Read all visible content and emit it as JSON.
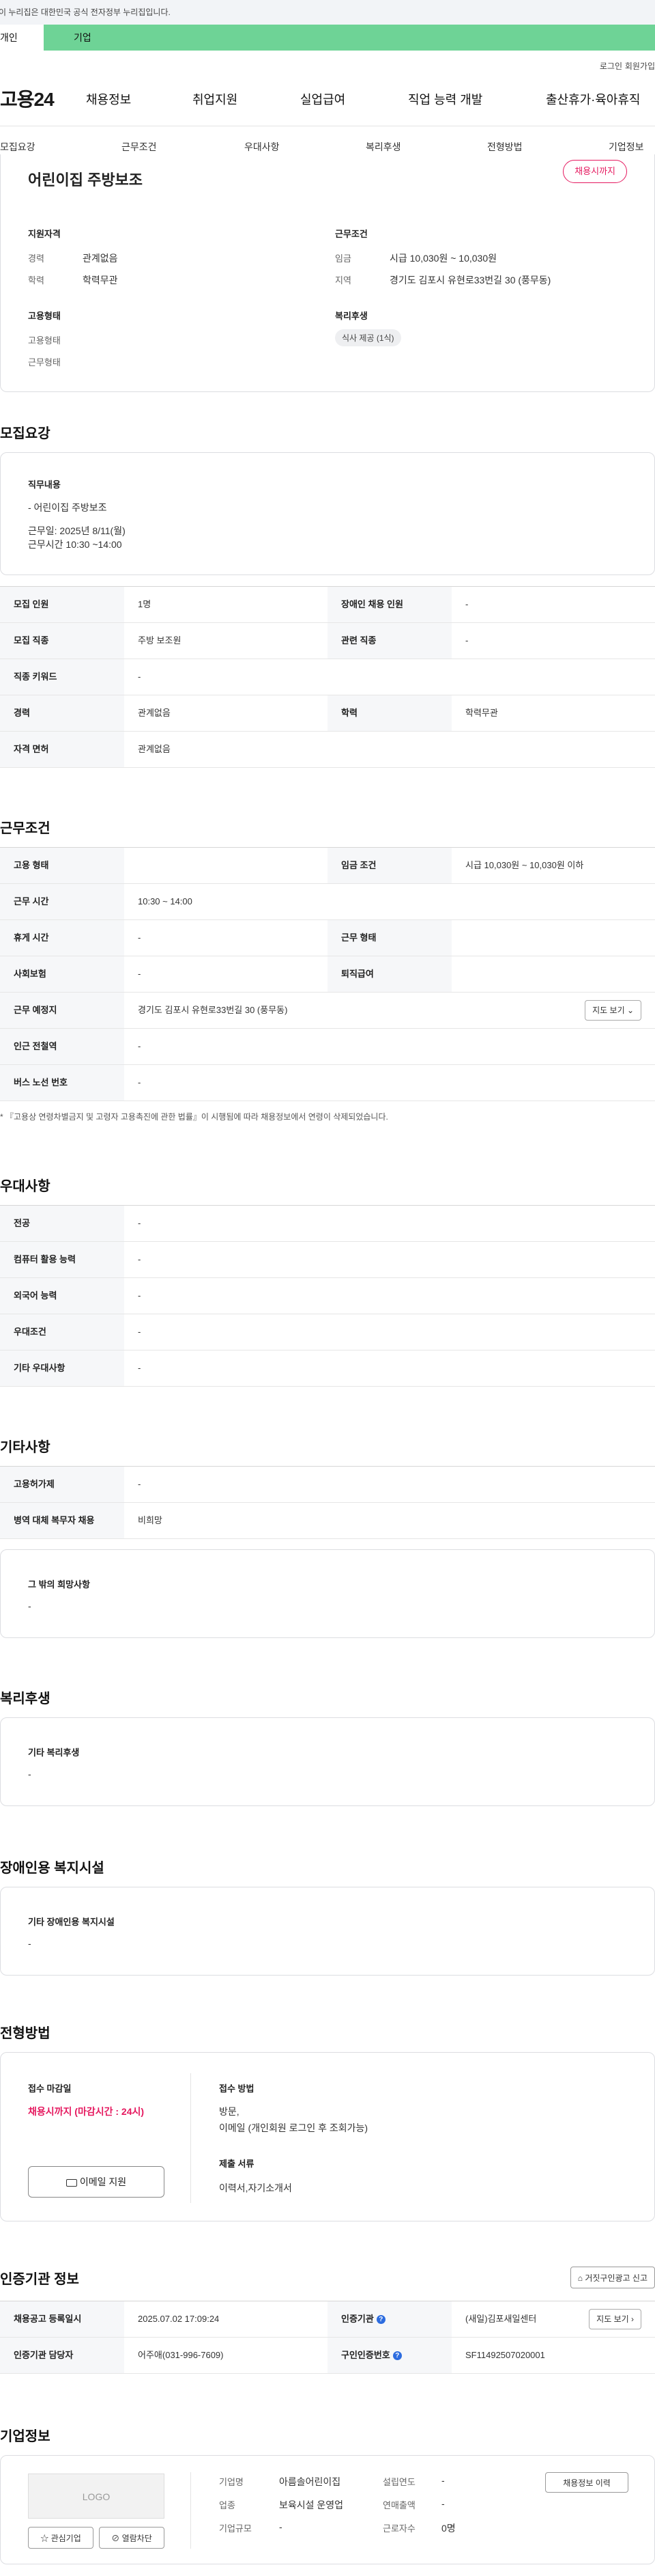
{
  "banner": {
    "text": "이 누리집은 대한민국 공식 전자정부 누리집입니다."
  },
  "user_tabs": {
    "personal": "개인",
    "corp": "기업"
  },
  "util": {
    "login": "로그인",
    "join": "회원가입"
  },
  "gnb": {
    "logo": "고용24",
    "menu": [
      "채용정보",
      "취업지원",
      "실업급여",
      "직업 능력 개발",
      "출산휴가·육아휴직"
    ]
  },
  "subnav": [
    "모집요강",
    "근무조건",
    "우대사항",
    "복리후생",
    "전형방법",
    "기업정보"
  ],
  "job": {
    "title": "어린이집 주방보조",
    "status_badge": "채용시까지",
    "qual_title": "지원자격",
    "qual": [
      {
        "k": "경력",
        "v": "관계없음"
      },
      {
        "k": "학력",
        "v": "학력무관"
      }
    ],
    "cond_title": "근무조건",
    "cond": [
      {
        "k": "임금",
        "v": "시급 10,030원 ~ 10,030원"
      },
      {
        "k": "지역",
        "v": "경기도 김포시 유현로33번길 30 (풍무동)"
      }
    ],
    "emp_title": "고용형태",
    "emp": [
      "고용형태",
      "근무형태"
    ],
    "welfare_title": "복리후생",
    "welfare_pill": "식사 제공 (1식)"
  },
  "recruit": {
    "section": "모집요강",
    "duty_title": "직무내용",
    "duty_lines": [
      "- 어린이집 주방보조",
      "근무일: 2025년 8/11(월)",
      "근무시간 10:30 ~14:00"
    ],
    "rows": [
      {
        "th1": "모집 인원",
        "td1": "1명",
        "th2": "장애인 채용 인원",
        "td2": "-"
      },
      {
        "th1": "모집 직종",
        "td1": "주방 보조원",
        "th2": "관련 직종",
        "td2": "-"
      },
      {
        "th1": "직종 키워드",
        "td1": "-"
      },
      {
        "th1": "경력",
        "td1": "관계없음",
        "th2": "학력",
        "td2": "학력무관"
      },
      {
        "th1": "자격 면허",
        "td1": "관계없음"
      }
    ]
  },
  "workcond": {
    "section": "근무조건",
    "rows": [
      {
        "th1": "고용 형태",
        "td1": "",
        "th2": "임금 조건",
        "td2": "시급 10,030원 ~ 10,030원 이하"
      },
      {
        "th1": "근무 시간",
        "td1": "10:30 ~ 14:00"
      },
      {
        "th1": "휴게 시간",
        "td1": "-",
        "th2": "근무 형태",
        "td2": ""
      },
      {
        "th1": "사회보험",
        "td1": "-",
        "th2": "퇴직급여",
        "td2": ""
      },
      {
        "th1": "근무 예정지",
        "td1": "경기도 김포시 유현로33번길 30 (풍무동)",
        "btn": "지도 보기 ⌄"
      },
      {
        "th1": "인근 전철역",
        "td1": "-"
      },
      {
        "th1": "버스 노선 번호",
        "td1": "-"
      }
    ],
    "note": "* 『고용상 연령차별금지 및 고령자 고용촉진에 관한 법률』이 시행됨에 따라 채용정보에서 연령이 삭제되었습니다."
  },
  "pref": {
    "section": "우대사항",
    "rows": [
      {
        "th1": "전공",
        "td1": "-"
      },
      {
        "th1": "컴퓨터 활용 능력",
        "td1": "-"
      },
      {
        "th1": "외국어 능력",
        "td1": "-"
      },
      {
        "th1": "우대조건",
        "td1": "-"
      },
      {
        "th1": "기타 우대사항",
        "td1": "-"
      }
    ]
  },
  "etc": {
    "section": "기타사항",
    "rows": [
      {
        "th1": "고용허가제",
        "td1": "-"
      },
      {
        "th1": "병역 대체 복무자 채용",
        "td1": "비희망"
      }
    ],
    "box_title": "그 밖의 희망사항",
    "box_val": "-"
  },
  "welfare": {
    "section": "복리후생",
    "box_title": "기타 복리후생",
    "box_val": "-"
  },
  "disabled": {
    "section": "장애인용 복지시설",
    "box_title": "기타 장애인용 복지시설",
    "box_val": "-"
  },
  "screening": {
    "section": "전형방법",
    "deadline_title": "접수 마감일",
    "deadline_val": "채용시까지 (마감시간 : 24시)",
    "email_btn": "이메일 지원",
    "method_title": "접수 방법",
    "method_lines": [
      "방문,",
      "이메일 (개인회원 로그인 후 조회가능)"
    ],
    "docs_title": "제출 서류",
    "docs_val": "이력서,자기소개서"
  },
  "cert": {
    "section": "인증기관 정보",
    "report_btn": "거짓구인광고 신고",
    "row1": {
      "th1": "채용공고 등록일시",
      "td1": "2025.07.02 17:09:24",
      "th2": "인증기관",
      "td2": "(새일)김포새일센터",
      "btn": "지도 보기 ›"
    },
    "row2": {
      "th1": "인증기관 담당자",
      "td1": "어주애(031-996-7609)",
      "th2": "구인인증번호",
      "td2": "SF11492507020001"
    }
  },
  "company": {
    "section": "기업정보",
    "logo": "LOGO",
    "fav_btn": "☆ 관심기업",
    "block_btn": "열람차단",
    "info_btn": "채용정보 이력",
    "f": [
      {
        "k": "기업명",
        "v": "아름솔어린이집"
      },
      {
        "k": "업종",
        "v": "보육시설 운영업"
      },
      {
        "k": "기업규모",
        "v": "-"
      }
    ],
    "g": [
      {
        "k": "설립연도",
        "v": "-"
      },
      {
        "k": "연매출액",
        "v": "-"
      },
      {
        "k": "근로자수",
        "v": "0명"
      }
    ]
  }
}
